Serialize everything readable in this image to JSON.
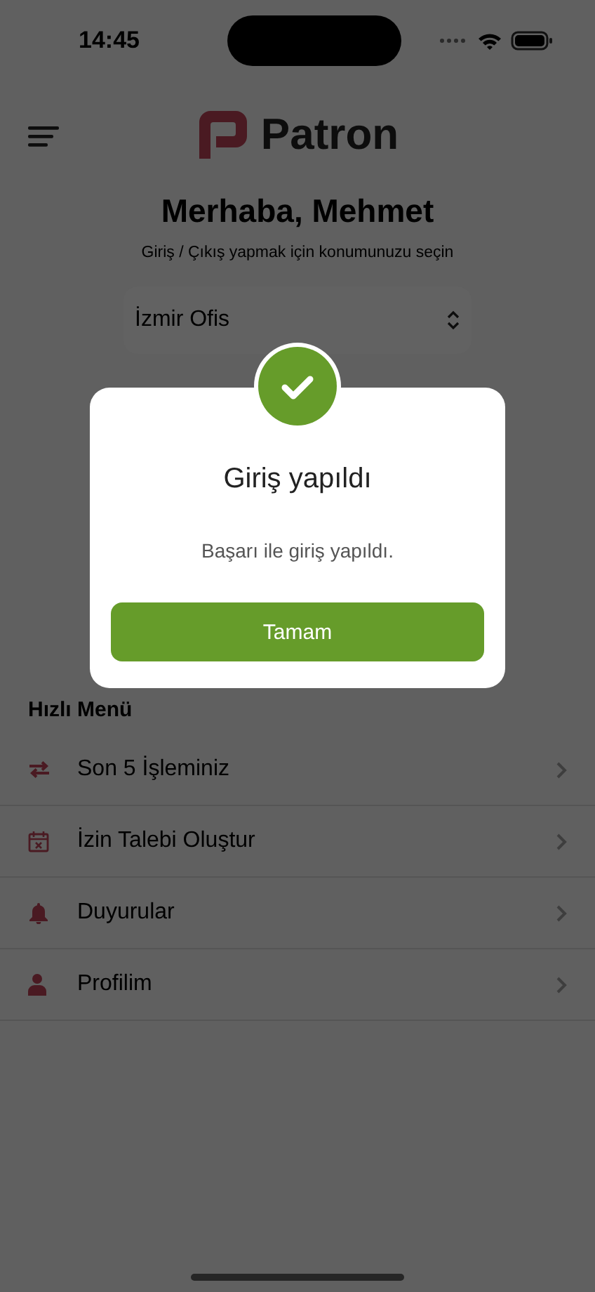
{
  "status_bar": {
    "time": "14:45"
  },
  "header": {
    "logo_text": "Patron"
  },
  "greeting": {
    "title": "Merhaba, Mehmet",
    "subtitle": "Giriş / Çıkış yapmak için konumunuzu seçin"
  },
  "location_select": {
    "value": "İzmir Ofis"
  },
  "quick_menu": {
    "title": "Hızlı Menü",
    "items": [
      {
        "label": "Son 5 İşleminiz",
        "kind": "transfer"
      },
      {
        "label": "İzin Talebi Oluştur",
        "kind": "calendar"
      },
      {
        "label": "Duyurular",
        "kind": "bell"
      },
      {
        "label": "Profilim",
        "kind": "person"
      }
    ]
  },
  "dialog": {
    "title": "Giriş yapıldı",
    "message": "Başarı ile giriş yapıldı.",
    "button": "Tamam"
  }
}
